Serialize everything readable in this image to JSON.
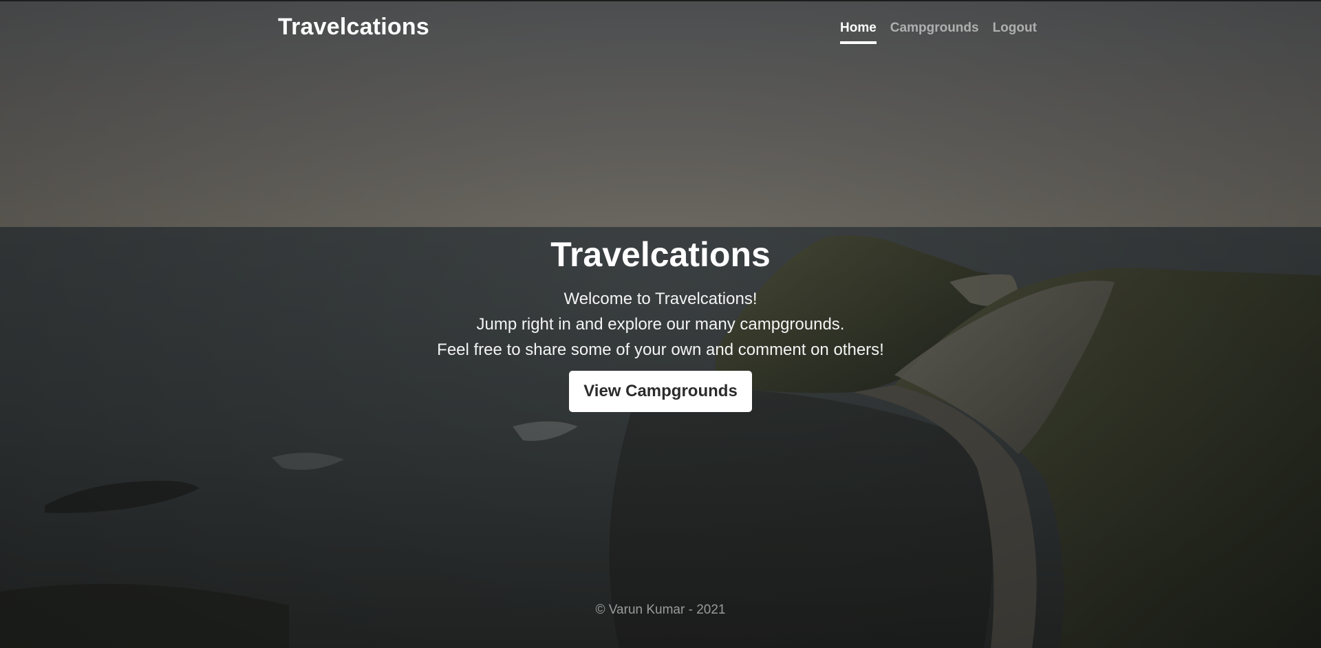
{
  "header": {
    "brand": "Travelcations",
    "nav": [
      {
        "label": "Home",
        "active": true
      },
      {
        "label": "Campgrounds",
        "active": false
      },
      {
        "label": "Logout",
        "active": false
      }
    ]
  },
  "hero": {
    "title": "Travelcations",
    "lines": [
      "Welcome to Travelcations!",
      "Jump right in and explore our many campgrounds.",
      "Feel free to share some of your own and comment on others!"
    ],
    "button_label": "View Campgrounds"
  },
  "footer": {
    "text": "© Varun Kumar - 2021"
  },
  "colors": {
    "text": "#ffffff",
    "muted_text": "rgba(255,255,255,0.55)",
    "button_bg": "#ffffff",
    "button_text": "#2b2b2b"
  }
}
